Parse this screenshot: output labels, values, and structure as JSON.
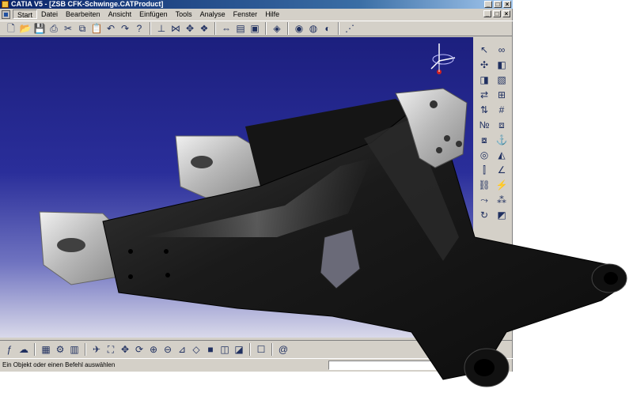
{
  "window": {
    "title": "CATIA V5 - [ZSB CFK-Schwinge.CATProduct]",
    "controls": [
      "_",
      "□",
      "×"
    ]
  },
  "menu": {
    "items": [
      {
        "label": "Start",
        "active": true
      },
      {
        "label": "Datei"
      },
      {
        "label": "Bearbeiten"
      },
      {
        "label": "Ansicht"
      },
      {
        "label": "Einfügen"
      },
      {
        "label": "Tools"
      },
      {
        "label": "Analyse"
      },
      {
        "label": "Fenster"
      },
      {
        "label": "Hilfe"
      }
    ]
  },
  "toolbar_top": {
    "icons": [
      "new-icon",
      "open-icon",
      "save-icon",
      "print-icon",
      "cut-icon",
      "copy-icon",
      "paste-icon",
      "undo-icon",
      "redo-icon",
      "whats-this-icon",
      "sep",
      "constraint-icon",
      "snap-icon",
      "manipulate-icon",
      "explode-icon",
      "sep",
      "measure-icon",
      "catalog-icon",
      "product-icon",
      "sep",
      "apply-material-icon",
      "sep",
      "render-icon",
      "photo-studio-icon",
      "scene-icon",
      "sep",
      "grid-icon"
    ]
  },
  "toolbar_right": {
    "icons": [
      "select-arrow-icon",
      "fly-mode-icon",
      "pan-icon",
      "component-icon",
      "product-insert-icon",
      "existing-component-icon",
      "replace-icon",
      "graph-tree-icon",
      "reorder-icon",
      "numbering-icon",
      "generate-numbering-icon",
      "multi-instantiation-icon",
      "fast-multi-instantiation-icon",
      "constraint-fix-icon",
      "coincidence-icon",
      "contact-icon",
      "offset-icon",
      "angle-icon",
      "fix-together-icon",
      "quick-constraint-icon",
      "flexible-icon",
      "reuse-pattern-icon",
      "update-icon",
      "sectioning-icon"
    ]
  },
  "toolbar_bottom": {
    "icons": [
      "formula-icon",
      "knowledge-icon",
      "sep",
      "table-icon",
      "parameter-icon",
      "properties-icon",
      "sep",
      "fly-icon",
      "fit-all-icon",
      "pan-move-icon",
      "rotate-icon",
      "zoom-in-icon",
      "zoom-out-icon",
      "normal-view-icon",
      "iso-view-icon",
      "shading-icon",
      "hide-show-icon",
      "swap-visible-icon",
      "sep",
      "view-mode-icon",
      "sep",
      "update-all-icon"
    ]
  },
  "status": {
    "message": "Ein Objekt oder einen Befehl auswählen",
    "command_input": ""
  },
  "colors": {
    "viewport_top": "#1c1f7e",
    "viewport_bottom": "#d9d9ea",
    "carbon": "#1a1a1a",
    "aluminium": "#c8c8c8"
  }
}
